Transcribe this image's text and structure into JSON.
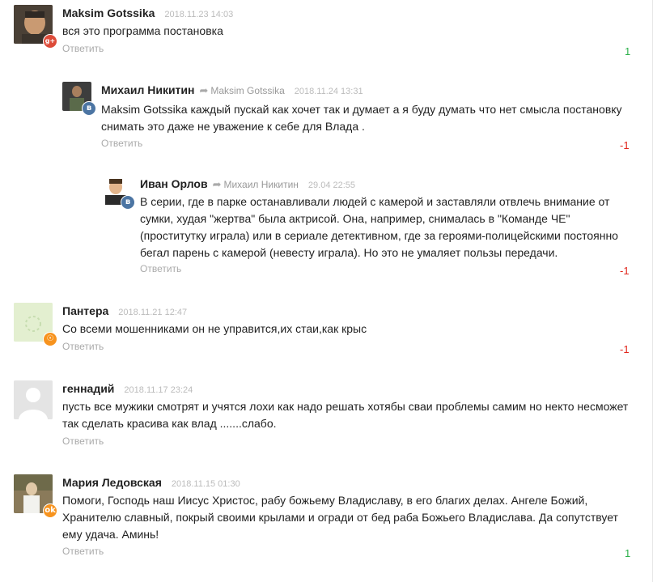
{
  "comments": [
    {
      "author": "Maksim Gotssika",
      "date": "2018.11.23 14:03",
      "text": "вся это программа постановка",
      "reply_label": "Ответить",
      "rating": "1",
      "network": "g+"
    },
    {
      "author": "Михаил Никитин",
      "reply_to": "Maksim Gotssika",
      "date": "2018.11.24 13:31",
      "text": "Maksim Gotssika каждый пускай как хочет так и думает а я буду думать что нет смысла постановку снимать это даже не уважение к себе для Влада .",
      "reply_label": "Ответить",
      "rating": "-1",
      "network": "в"
    },
    {
      "author": "Иван Орлов",
      "reply_to": "Михаил Никитин",
      "date": "29.04 22:55",
      "text": "В серии, где в парке останавливали людей с камерой и заставляли отвлечь внимание от сумки, худая \"жертва\" была актрисой. Она, например, снималась в \"Команде ЧЕ\" (проститутку играла) или в сериале детективном, где за героями-полицейскими постоянно бегал парень с камерой (невесту играла). Но это не умаляет пользы передачи.",
      "reply_label": "Ответить",
      "rating": "-1",
      "network": "в"
    },
    {
      "author": "Пантера",
      "date": "2018.11.21 12:47",
      "text": "Со всеми мошенниками он не управится,их стаи,как крыс",
      "reply_label": "Ответить",
      "rating": "-1",
      "network": "ok"
    },
    {
      "author": "геннадий",
      "date": "2018.11.17 23:24",
      "text": "пусть все мужики смотрят и учятся лохи как надо решать хотябы сваи проблемы самим но некто несможет так сделать красива как влад .......слабо.",
      "reply_label": "Ответить",
      "rating": ""
    },
    {
      "author": "Мария Ледовская",
      "date": "2018.11.15 01:30",
      "text": "Помоги, Господь наш Иисус Христос, рабу божьему Владиславу, в его благих делах. Ангеле Божий, Хранителю славный, покрый своими крылами и огради от бед раба Божьего Владислава. Да сопутствует ему удача. Аминь!",
      "reply_label": "Ответить",
      "rating": "1",
      "network": "ok"
    }
  ],
  "colors": {
    "positive": "#2db14b",
    "negative": "#e1261c",
    "vk": "#4c75a3",
    "gplus": "#dd4b39",
    "ok": "#f7931e"
  }
}
